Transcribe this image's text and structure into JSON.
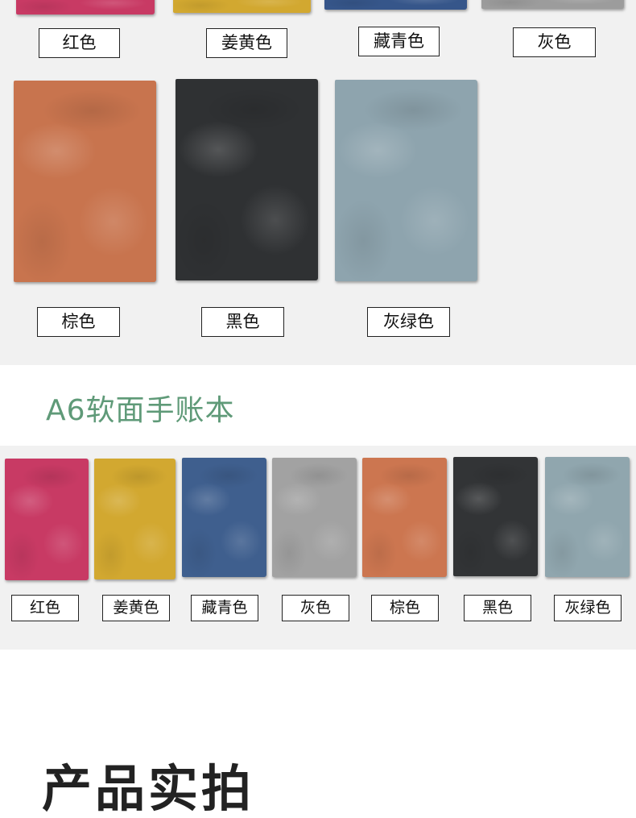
{
  "a5_section": {
    "top_row_labels": [
      "红色",
      "姜黄色",
      "藏青色",
      "灰色"
    ],
    "bottom_row_labels": [
      "棕色",
      "黑色",
      "灰绿色"
    ],
    "top_row_colors": [
      "#c83a64",
      "#d2a830",
      "#36568a",
      "#9c9c9c"
    ],
    "bottom_row_colors": [
      "#c8744e",
      "#2f3133",
      "#8ea4ae"
    ]
  },
  "a6_section": {
    "title": "A6软面手账本",
    "title_color": "#5f9a78",
    "labels": [
      "红色",
      "姜黄色",
      "藏青色",
      "灰色",
      "棕色",
      "黑色",
      "灰绿色"
    ],
    "colors": [
      "#c83a64",
      "#d2a830",
      "#3f5f8e",
      "#a2a2a2",
      "#cc7650",
      "#323436",
      "#90a6ae"
    ]
  },
  "photo_section": {
    "title": "产品实拍"
  }
}
